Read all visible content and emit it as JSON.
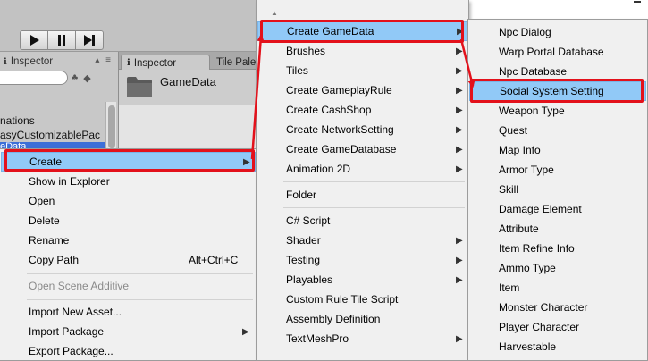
{
  "toolbar": {
    "play_icon": "play-icon",
    "pause_icon": "pause-icon",
    "step_icon": "step-icon"
  },
  "left_panel": {
    "tab_label": "Inspector",
    "tab_icon": "info-icon",
    "tab_tools": "▴ ≡",
    "tree_lines": [
      "nations",
      "asyCustomizablePac",
      "eData"
    ]
  },
  "inspector": {
    "tab_label": "Inspector",
    "tab_icon": "info-icon",
    "other_tab_label": "Tile Pale",
    "asset_name": "GameData",
    "asset_icon": "folder-icon"
  },
  "menu1": {
    "items": [
      {
        "label": "Create",
        "submenu": true,
        "highlighted": true
      },
      {
        "label": "Show in Explorer"
      },
      {
        "label": "Open"
      },
      {
        "label": "Delete"
      },
      {
        "label": "Rename"
      },
      {
        "label": "Copy Path",
        "shortcut": "Alt+Ctrl+C"
      },
      {
        "label": "Open Scene Additive",
        "disabled": true
      },
      {
        "label": "Import New Asset..."
      },
      {
        "label": "Import Package",
        "submenu": true
      },
      {
        "label": "Export Package..."
      }
    ]
  },
  "menu2": {
    "scroll_glyph": "▲",
    "items": [
      {
        "label": "Create GameData",
        "submenu": true,
        "highlighted": true
      },
      {
        "label": "Brushes",
        "submenu": true
      },
      {
        "label": "Tiles",
        "submenu": true
      },
      {
        "label": "Create GameplayRule",
        "submenu": true
      },
      {
        "label": "Create CashShop",
        "submenu": true
      },
      {
        "label": "Create NetworkSetting",
        "submenu": true
      },
      {
        "label": "Create GameDatabase",
        "submenu": true
      },
      {
        "label": "Animation 2D",
        "submenu": true
      },
      {
        "label": "Folder"
      },
      {
        "label": "C# Script"
      },
      {
        "label": "Shader",
        "submenu": true
      },
      {
        "label": "Testing",
        "submenu": true
      },
      {
        "label": "Playables",
        "submenu": true
      },
      {
        "label": "Custom Rule Tile Script"
      },
      {
        "label": "Assembly Definition"
      },
      {
        "label": "TextMeshPro",
        "submenu": true
      }
    ]
  },
  "menu3": {
    "items": [
      {
        "label": "Npc Dialog"
      },
      {
        "label": "Warp Portal Database"
      },
      {
        "label": "Npc Database"
      },
      {
        "label": "Social System Setting",
        "highlighted": true
      },
      {
        "label": "Weapon Type"
      },
      {
        "label": "Quest"
      },
      {
        "label": "Map Info"
      },
      {
        "label": "Armor Type"
      },
      {
        "label": "Skill"
      },
      {
        "label": "Damage Element"
      },
      {
        "label": "Attribute"
      },
      {
        "label": "Item Refine Info"
      },
      {
        "label": "Ammo Type"
      },
      {
        "label": "Item"
      },
      {
        "label": "Monster Character"
      },
      {
        "label": "Player Character"
      },
      {
        "label": "Harvestable"
      }
    ]
  },
  "colors": {
    "highlight": "#91c9f7",
    "annotation_red": "#e3111b",
    "menu_bg": "#f0f0f0"
  }
}
